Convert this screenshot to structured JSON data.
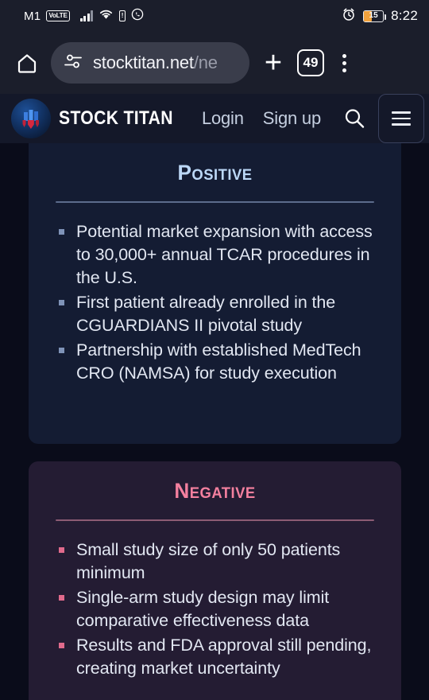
{
  "status_bar": {
    "carrier": "M1",
    "volte_badge": "VoLTE",
    "battery_percent": "15",
    "time": "8:22"
  },
  "browser": {
    "url_visible": "stocktitan.net",
    "url_dim": "/ne",
    "tab_count": "49"
  },
  "site_header": {
    "brand": "STOCK TITAN",
    "login_label": "Login",
    "signup_label": "Sign up"
  },
  "content": {
    "positive": {
      "title": "Positive",
      "bullets": [
        "Potential market expansion with access to 30,000+ annual TCAR procedures in the U.S.",
        "First patient already enrolled in the CGUARDIANS II pivotal study",
        "Partnership with established MedTech CRO (NAMSA) for study execution"
      ]
    },
    "negative": {
      "title": "Negative",
      "bullets": [
        "Small study size of only 50 patients minimum",
        "Single-arm study design may limit comparative effectiveness data",
        "Results and FDA approval still pending, creating market uncertainty"
      ]
    }
  },
  "colors": {
    "positive_title": "#bcd8f7",
    "negative_title": "#f4809f",
    "positive_card_bg": "#141c33",
    "negative_card_bg": "#241c33",
    "battery_accent": "#f2a23c"
  }
}
